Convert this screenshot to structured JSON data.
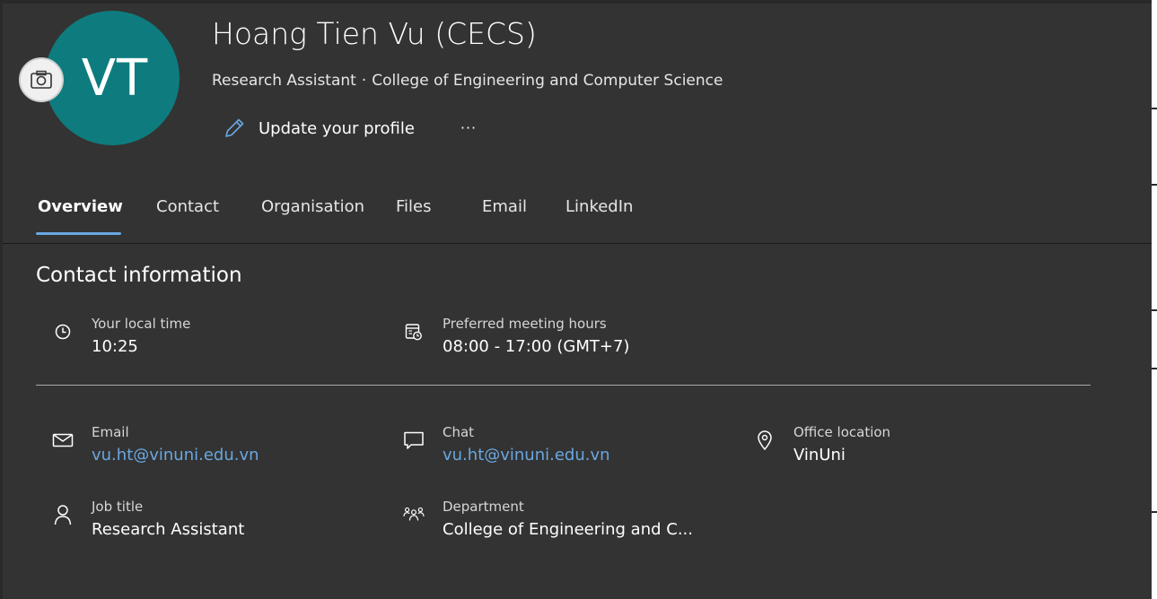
{
  "profile": {
    "initials": "VT",
    "name": "Hoang Tien Vu (CECS)",
    "job_title": "Research Assistant",
    "separator": "·",
    "department": "College of Engineering and Computer Science",
    "update_label": "Update your profile",
    "more_label": "···",
    "avatar_color": "#0e7c7e"
  },
  "tabs": [
    {
      "label": "Overview",
      "active": true
    },
    {
      "label": "Contact"
    },
    {
      "label": "Organisation"
    },
    {
      "label": "Files"
    },
    {
      "label": "Email"
    },
    {
      "label": "LinkedIn"
    }
  ],
  "contact": {
    "title": "Contact information",
    "local_time": {
      "label": "Your local time",
      "value": "10:25",
      "icon": "clock-icon"
    },
    "meeting_hours": {
      "label": "Preferred meeting hours",
      "value": "08:00 - 17:00 (GMT+7)",
      "icon": "calendar-clock-icon"
    },
    "email": {
      "label": "Email",
      "value": "vu.ht@vinuni.edu.vn",
      "icon": "mail-icon"
    },
    "chat": {
      "label": "Chat",
      "value": "vu.ht@vinuni.edu.vn",
      "icon": "chat-icon"
    },
    "office": {
      "label": "Office location",
      "value": "VinUni",
      "icon": "location-pin-icon"
    },
    "job": {
      "label": "Job title",
      "value": "Research Assistant",
      "icon": "person-icon"
    },
    "department": {
      "label": "Department",
      "value": "College of Engineering and C...",
      "icon": "people-group-icon"
    }
  },
  "theme": {
    "link_color": "#6aa7e0",
    "accent": "#6aa7e0"
  }
}
